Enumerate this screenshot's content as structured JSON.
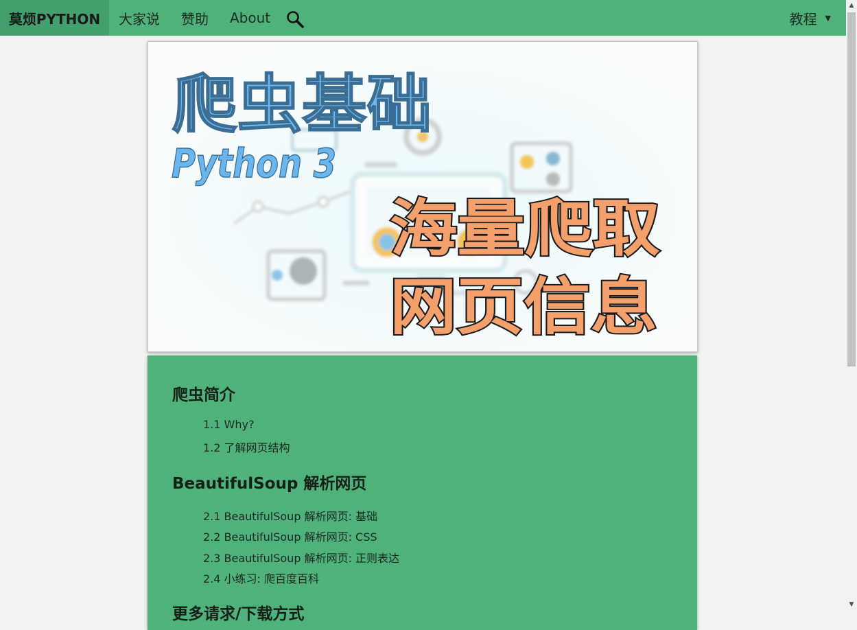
{
  "nav": {
    "brand": "莫烦PYTHON",
    "links": [
      "大家说",
      "赞助",
      "About"
    ],
    "menu_label": "教程",
    "search_icon": "magnifier-icon"
  },
  "banner": {
    "title": "爬虫基础",
    "subtitle": "Python 3",
    "callout_line1": "海量爬取",
    "callout_line2": "网页信息"
  },
  "toc": {
    "sections": [
      {
        "title": "爬虫简介",
        "items": [
          "1.1 Why?",
          "1.2 了解网页结构"
        ]
      },
      {
        "title": "BeautifulSoup 解析网页",
        "items": [
          "2.1 BeautifulSoup 解析网页: 基础",
          "2.2 BeautifulSoup 解析网页: CSS",
          "2.3 BeautifulSoup 解析网页: 正则表达",
          "2.4 小练习: 爬百度百科"
        ]
      },
      {
        "title": "更多请求/下载方式",
        "items": []
      }
    ]
  },
  "colors": {
    "nav_bg": "#4fb27a",
    "brand_bg": "#43a06c",
    "panel_bg": "#4fb27a",
    "page_bg": "#f2f2f2"
  }
}
